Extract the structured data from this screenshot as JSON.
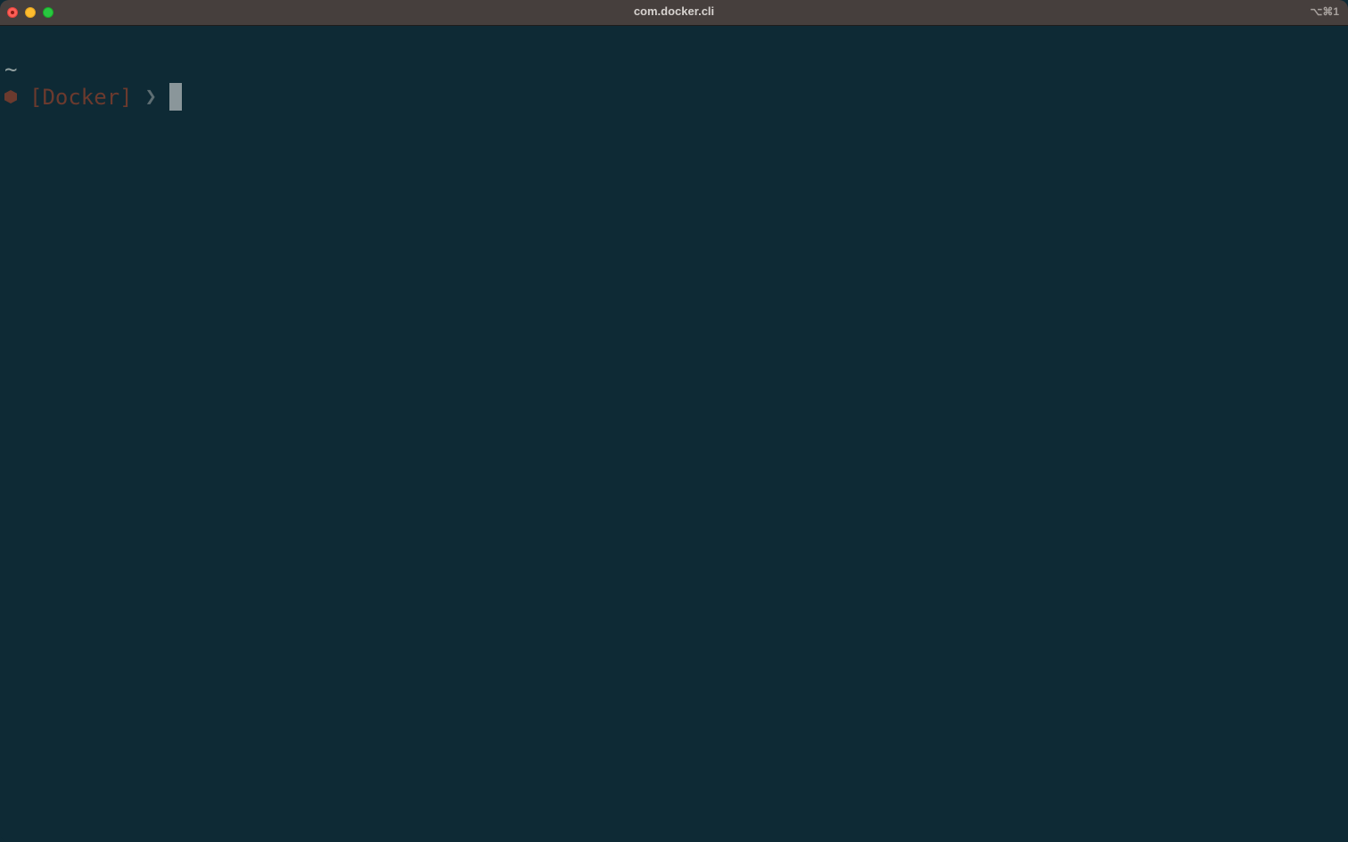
{
  "window": {
    "title": "com.docker.cli",
    "shortcut": "⌥⌘1"
  },
  "terminal": {
    "cwd": "~",
    "prompt_icon": "hexagon-icon",
    "context": "[Docker]",
    "prompt_arrow": "❯",
    "input": ""
  },
  "colors": {
    "background": "#0e2a35",
    "titlebar": "#463f3d",
    "context": "#6b3a2e",
    "cursor": "#8a969a"
  }
}
